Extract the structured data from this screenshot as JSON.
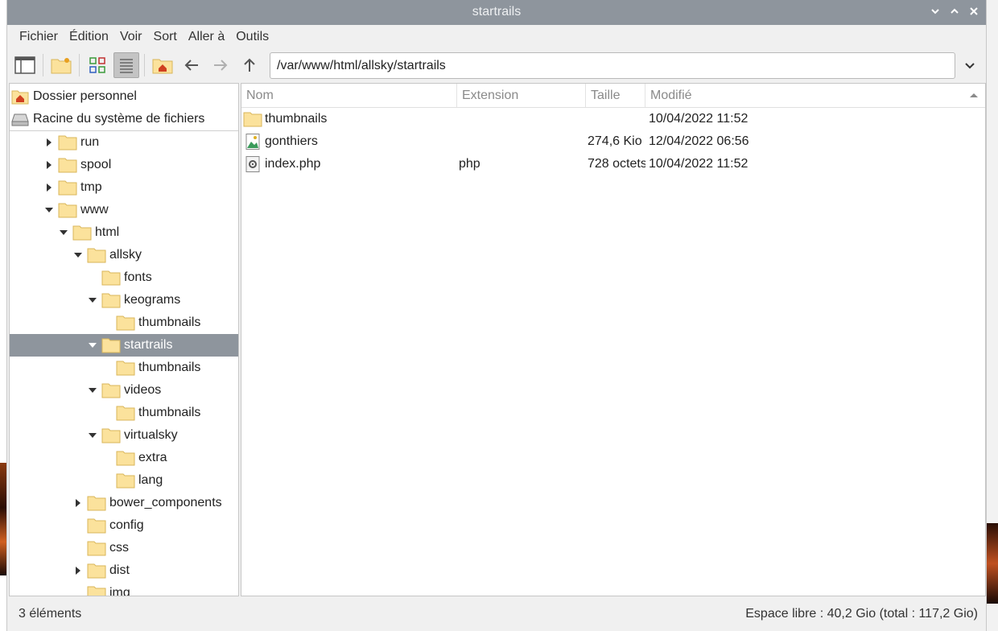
{
  "window": {
    "title": "startrails",
    "controls": [
      "chevron-down",
      "chevron-up",
      "close"
    ]
  },
  "menubar": {
    "items": [
      "Fichier",
      "Édition",
      "Voir",
      "Sort",
      "Aller à",
      "Outils"
    ]
  },
  "toolbar": {
    "address": "/var/www/html/allsky/startrails"
  },
  "places": [
    {
      "label": "Dossier personnel",
      "icon": "home-folder-icon"
    },
    {
      "label": "Racine du système de fichiers",
      "icon": "drive-icon"
    }
  ],
  "tree": [
    {
      "label": "run",
      "depth": 0,
      "expander": "collapsed"
    },
    {
      "label": "spool",
      "depth": 0,
      "expander": "collapsed"
    },
    {
      "label": "tmp",
      "depth": 0,
      "expander": "collapsed"
    },
    {
      "label": "www",
      "depth": 0,
      "expander": "expanded"
    },
    {
      "label": "html",
      "depth": 1,
      "expander": "expanded"
    },
    {
      "label": "allsky",
      "depth": 2,
      "expander": "expanded"
    },
    {
      "label": "fonts",
      "depth": 3,
      "expander": "none"
    },
    {
      "label": "keograms",
      "depth": 3,
      "expander": "expanded"
    },
    {
      "label": "thumbnails",
      "depth": 4,
      "expander": "none"
    },
    {
      "label": "startrails",
      "depth": 3,
      "expander": "expanded",
      "selected": true
    },
    {
      "label": "thumbnails",
      "depth": 4,
      "expander": "none"
    },
    {
      "label": "videos",
      "depth": 3,
      "expander": "expanded"
    },
    {
      "label": "thumbnails",
      "depth": 4,
      "expander": "none"
    },
    {
      "label": "virtualsky",
      "depth": 3,
      "expander": "expanded"
    },
    {
      "label": "extra",
      "depth": 4,
      "expander": "none"
    },
    {
      "label": "lang",
      "depth": 4,
      "expander": "none"
    },
    {
      "label": "bower_components",
      "depth": 2,
      "expander": "collapsed"
    },
    {
      "label": "config",
      "depth": 2,
      "expander": "none"
    },
    {
      "label": "css",
      "depth": 2,
      "expander": "none"
    },
    {
      "label": "dist",
      "depth": 2,
      "expander": "collapsed"
    },
    {
      "label": "img",
      "depth": 2,
      "expander": "none"
    }
  ],
  "filelist": {
    "columns": [
      "Nom",
      "Extension",
      "Taille",
      "Modifié"
    ],
    "rows": [
      {
        "name": "thumbnails",
        "extension": "",
        "size": "",
        "modified": "10/04/2022 11:52",
        "icon": "folder-icon"
      },
      {
        "name": "gonthiers",
        "extension": "",
        "size": "274,6 Kio",
        "modified": "12/04/2022 06:56",
        "icon": "image-file-icon"
      },
      {
        "name": "index.php",
        "extension": "php",
        "size": "728 octets",
        "modified": "10/04/2022 11:52",
        "icon": "script-file-icon"
      }
    ]
  },
  "statusbar": {
    "left": "3 éléments",
    "right": "Espace libre : 40,2 Gio (total : 117,2 Gio)"
  },
  "colors": {
    "titlebar": "#8e959d",
    "selection": "#8e959d",
    "folder_fill": "#fbe29c",
    "folder_stroke": "#d9b65a"
  }
}
